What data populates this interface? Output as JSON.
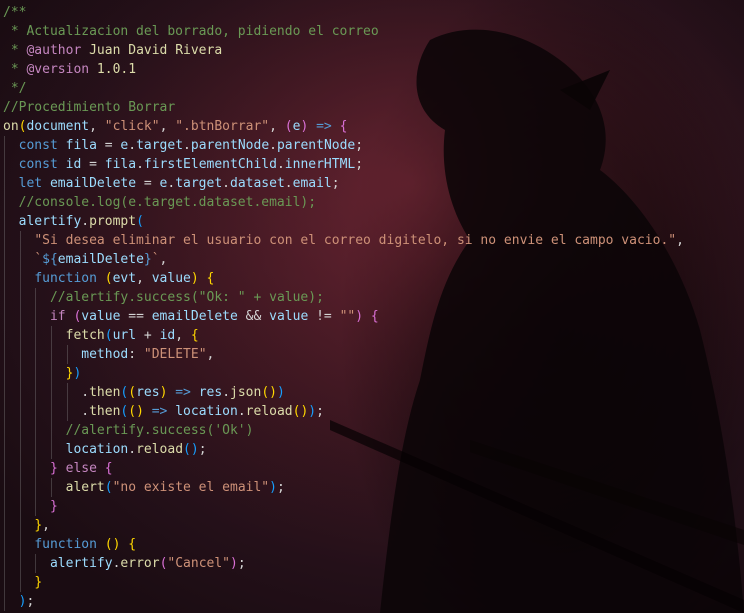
{
  "editor": {
    "language": "javascript",
    "theme_colors": {
      "comment": "#6a9955",
      "keyword": "#569cd6",
      "control": "#c586c0",
      "function": "#dcdcaa",
      "variable": "#9cdcfe",
      "string": "#ce9178",
      "punctuation": "#d4d4d4",
      "bracket_level_1": "#ffd700",
      "bracket_level_2": "#da70d6",
      "bracket_level_3": "#179fff"
    },
    "background": "dark red anime silhouette wallpaper",
    "lines": [
      {
        "indent": 0,
        "tokens": [
          [
            "comment",
            "/**"
          ]
        ]
      },
      {
        "indent": 0,
        "tokens": [
          [
            "comment",
            " * Actualizacion del borrado, pidiendo el correo"
          ]
        ]
      },
      {
        "indent": 0,
        "tokens": [
          [
            "comment",
            " * "
          ],
          [
            "tag",
            "@author"
          ],
          [
            "fn",
            " Juan David Rivera"
          ]
        ]
      },
      {
        "indent": 0,
        "tokens": [
          [
            "comment",
            " * "
          ],
          [
            "tag",
            "@version"
          ],
          [
            "fn",
            " 1.0.1"
          ]
        ]
      },
      {
        "indent": 0,
        "tokens": [
          [
            "comment",
            " */"
          ]
        ]
      },
      {
        "indent": 0,
        "tokens": [
          [
            "comment",
            "//Procedimiento Borrar"
          ]
        ]
      },
      {
        "indent": 0,
        "tokens": [
          [
            "fn",
            "on"
          ],
          [
            "br1",
            "("
          ],
          [
            "var",
            "document"
          ],
          [
            "plain",
            ", "
          ],
          [
            "str",
            "\"click\""
          ],
          [
            "plain",
            ", "
          ],
          [
            "str",
            "\".btnBorrar\""
          ],
          [
            "plain",
            ", "
          ],
          [
            "br2",
            "("
          ],
          [
            "var",
            "e"
          ],
          [
            "br2",
            ")"
          ],
          [
            "plain",
            " "
          ],
          [
            "kw",
            "=>"
          ],
          [
            "plain",
            " "
          ],
          [
            "br2",
            "{"
          ]
        ]
      },
      {
        "indent": 1,
        "tokens": [
          [
            "kw",
            "const"
          ],
          [
            "plain",
            " "
          ],
          [
            "var",
            "fila"
          ],
          [
            "plain",
            " = "
          ],
          [
            "var",
            "e"
          ],
          [
            "plain",
            "."
          ],
          [
            "var",
            "target"
          ],
          [
            "plain",
            "."
          ],
          [
            "var",
            "parentNode"
          ],
          [
            "plain",
            "."
          ],
          [
            "var",
            "parentNode"
          ],
          [
            "plain",
            ";"
          ]
        ]
      },
      {
        "indent": 1,
        "tokens": [
          [
            "kw",
            "const"
          ],
          [
            "plain",
            " "
          ],
          [
            "var",
            "id"
          ],
          [
            "plain",
            " = "
          ],
          [
            "var",
            "fila"
          ],
          [
            "plain",
            "."
          ],
          [
            "var",
            "firstElementChild"
          ],
          [
            "plain",
            "."
          ],
          [
            "var",
            "innerHTML"
          ],
          [
            "plain",
            ";"
          ]
        ]
      },
      {
        "indent": 1,
        "tokens": [
          [
            "kw",
            "let"
          ],
          [
            "plain",
            " "
          ],
          [
            "var",
            "emailDelete"
          ],
          [
            "plain",
            " = "
          ],
          [
            "var",
            "e"
          ],
          [
            "plain",
            "."
          ],
          [
            "var",
            "target"
          ],
          [
            "plain",
            "."
          ],
          [
            "var",
            "dataset"
          ],
          [
            "plain",
            "."
          ],
          [
            "var",
            "email"
          ],
          [
            "plain",
            ";"
          ]
        ]
      },
      {
        "indent": 1,
        "tokens": [
          [
            "comment",
            "//console.log(e.target.dataset.email);"
          ]
        ]
      },
      {
        "indent": 1,
        "tokens": [
          [
            "var",
            "alertify"
          ],
          [
            "plain",
            "."
          ],
          [
            "fn",
            "prompt"
          ],
          [
            "br3",
            "("
          ]
        ]
      },
      {
        "indent": 2,
        "tokens": [
          [
            "str",
            "\"Si desea eliminar el usuario con el correo digitelo, si no envie el campo vacio.\""
          ],
          [
            "plain",
            ","
          ]
        ]
      },
      {
        "indent": 2,
        "tokens": [
          [
            "str",
            "`"
          ],
          [
            "kw",
            "${"
          ],
          [
            "var",
            "emailDelete"
          ],
          [
            "kw",
            "}"
          ],
          [
            "str",
            "`"
          ],
          [
            "plain",
            ","
          ]
        ]
      },
      {
        "indent": 2,
        "tokens": [
          [
            "kw",
            "function"
          ],
          [
            "plain",
            " "
          ],
          [
            "br1",
            "("
          ],
          [
            "var",
            "evt"
          ],
          [
            "plain",
            ", "
          ],
          [
            "var",
            "value"
          ],
          [
            "br1",
            ")"
          ],
          [
            "plain",
            " "
          ],
          [
            "br1",
            "{"
          ]
        ]
      },
      {
        "indent": 3,
        "tokens": [
          [
            "comment",
            "//alertify.success(\"Ok: \" + value);"
          ]
        ]
      },
      {
        "indent": 3,
        "tokens": [
          [
            "ctrl",
            "if"
          ],
          [
            "plain",
            " "
          ],
          [
            "br2",
            "("
          ],
          [
            "var",
            "value"
          ],
          [
            "plain",
            " == "
          ],
          [
            "var",
            "emailDelete"
          ],
          [
            "plain",
            " && "
          ],
          [
            "var",
            "value"
          ],
          [
            "plain",
            " != "
          ],
          [
            "str",
            "\"\""
          ],
          [
            "br2",
            ")"
          ],
          [
            "plain",
            " "
          ],
          [
            "br2",
            "{"
          ]
        ]
      },
      {
        "indent": 4,
        "tokens": [
          [
            "fn",
            "fetch"
          ],
          [
            "br3",
            "("
          ],
          [
            "var",
            "url"
          ],
          [
            "plain",
            " + "
          ],
          [
            "var",
            "id"
          ],
          [
            "plain",
            ", "
          ],
          [
            "br1",
            "{"
          ]
        ]
      },
      {
        "indent": 5,
        "tokens": [
          [
            "var",
            "method"
          ],
          [
            "plain",
            ": "
          ],
          [
            "str",
            "\"DELETE\""
          ],
          [
            "plain",
            ","
          ]
        ]
      },
      {
        "indent": 4,
        "tokens": [
          [
            "br1",
            "}"
          ],
          [
            "br3",
            ")"
          ]
        ]
      },
      {
        "indent": 5,
        "tokens": [
          [
            "plain",
            "."
          ],
          [
            "fn",
            "then"
          ],
          [
            "br3",
            "("
          ],
          [
            "br1",
            "("
          ],
          [
            "var",
            "res"
          ],
          [
            "br1",
            ")"
          ],
          [
            "plain",
            " "
          ],
          [
            "kw",
            "=>"
          ],
          [
            "plain",
            " "
          ],
          [
            "var",
            "res"
          ],
          [
            "plain",
            "."
          ],
          [
            "fn",
            "json"
          ],
          [
            "br1",
            "()"
          ],
          [
            "br3",
            ")"
          ]
        ]
      },
      {
        "indent": 5,
        "tokens": [
          [
            "plain",
            "."
          ],
          [
            "fn",
            "then"
          ],
          [
            "br3",
            "("
          ],
          [
            "br1",
            "()"
          ],
          [
            "plain",
            " "
          ],
          [
            "kw",
            "=>"
          ],
          [
            "plain",
            " "
          ],
          [
            "var",
            "location"
          ],
          [
            "plain",
            "."
          ],
          [
            "fn",
            "reload"
          ],
          [
            "br1",
            "()"
          ],
          [
            "br3",
            ")"
          ],
          [
            "plain",
            ";"
          ]
        ]
      },
      {
        "indent": 4,
        "tokens": [
          [
            "comment",
            "//alertify.success('Ok')"
          ]
        ]
      },
      {
        "indent": 4,
        "tokens": [
          [
            "var",
            "location"
          ],
          [
            "plain",
            "."
          ],
          [
            "fn",
            "reload"
          ],
          [
            "br3",
            "()"
          ],
          [
            "plain",
            ";"
          ]
        ]
      },
      {
        "indent": 3,
        "tokens": [
          [
            "br2",
            "}"
          ],
          [
            "plain",
            " "
          ],
          [
            "ctrl",
            "else"
          ],
          [
            "plain",
            " "
          ],
          [
            "br2",
            "{"
          ]
        ]
      },
      {
        "indent": 4,
        "tokens": [
          [
            "fn",
            "alert"
          ],
          [
            "br3",
            "("
          ],
          [
            "str",
            "\"no existe el email\""
          ],
          [
            "br3",
            ")"
          ],
          [
            "plain",
            ";"
          ]
        ]
      },
      {
        "indent": 3,
        "tokens": [
          [
            "br2",
            "}"
          ]
        ]
      },
      {
        "indent": 2,
        "tokens": [
          [
            "br1",
            "}"
          ],
          [
            "plain",
            ","
          ]
        ]
      },
      {
        "indent": 2,
        "tokens": [
          [
            "kw",
            "function"
          ],
          [
            "plain",
            " "
          ],
          [
            "br1",
            "()"
          ],
          [
            "plain",
            " "
          ],
          [
            "br1",
            "{"
          ]
        ]
      },
      {
        "indent": 3,
        "tokens": [
          [
            "var",
            "alertify"
          ],
          [
            "plain",
            "."
          ],
          [
            "fn",
            "error"
          ],
          [
            "br2",
            "("
          ],
          [
            "str",
            "\"Cancel\""
          ],
          [
            "br2",
            ")"
          ],
          [
            "plain",
            ";"
          ]
        ]
      },
      {
        "indent": 2,
        "tokens": [
          [
            "br1",
            "}"
          ]
        ]
      },
      {
        "indent": 1,
        "tokens": [
          [
            "br3",
            ")"
          ],
          [
            "plain",
            ";"
          ]
        ]
      }
    ]
  }
}
